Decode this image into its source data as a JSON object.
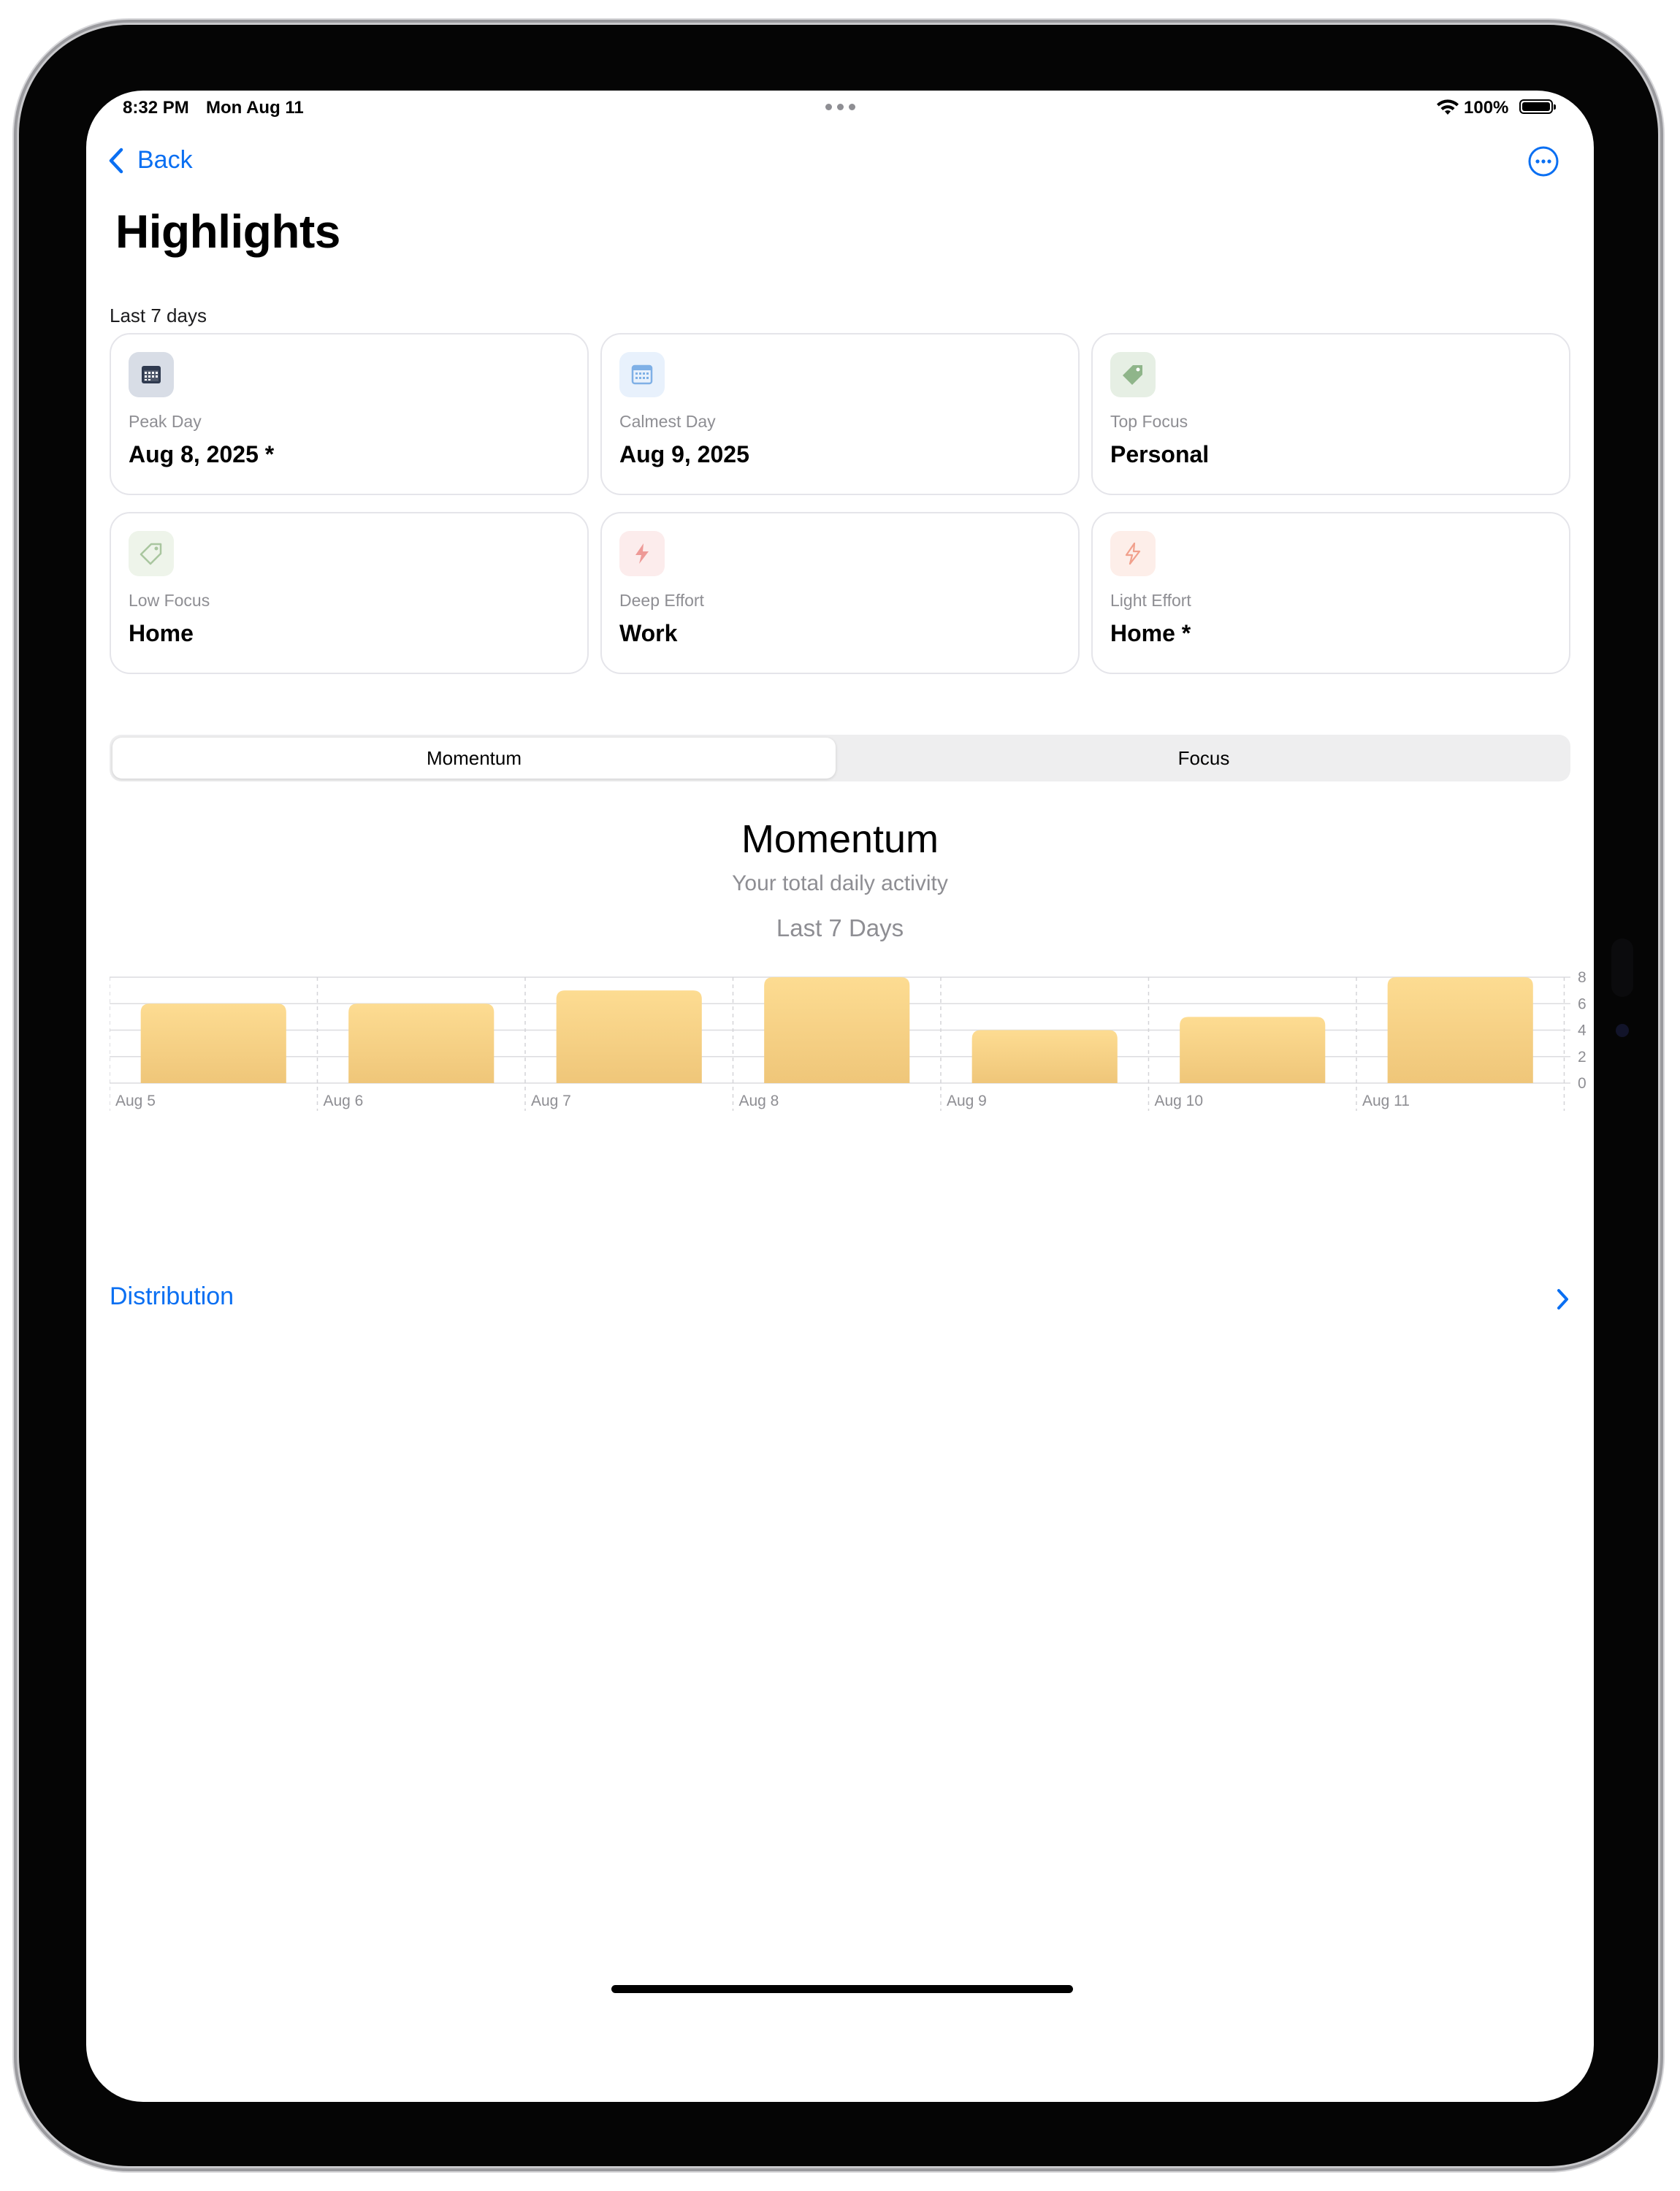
{
  "status_bar": {
    "time": "8:32 PM",
    "date": "Mon Aug 11",
    "battery": "100%"
  },
  "nav": {
    "back_label": "Back",
    "more_icon": "ellipsis-circle-icon"
  },
  "page": {
    "title": "Highlights",
    "section_label": "Last 7 days"
  },
  "cards": [
    {
      "label": "Peak Day",
      "value": "Aug 8, 2025 *",
      "icon": "calendar-icon",
      "icon_color": "#2f3a4f",
      "icon_bg": "#d8dde6"
    },
    {
      "label": "Calmest Day",
      "value": "Aug 9, 2025",
      "icon": "calendar-icon",
      "icon_color": "#7fb0e6",
      "icon_bg": "#e8f1fc"
    },
    {
      "label": "Top Focus",
      "value": "Personal",
      "icon": "tag-icon",
      "icon_color": "#8fb58a",
      "icon_bg": "#e6efe4"
    },
    {
      "label": "Low Focus",
      "value": "Home",
      "icon": "tag-icon",
      "icon_color": "#a9c69f",
      "icon_bg": "#eef4ea"
    },
    {
      "label": "Deep Effort",
      "value": "Work",
      "icon": "bolt-icon",
      "icon_color": "#ee9a97",
      "icon_bg": "#fcecec"
    },
    {
      "label": "Light Effort",
      "value": "Home *",
      "icon": "bolt-icon",
      "icon_color": "#f1a08c",
      "icon_bg": "#fdeee9"
    }
  ],
  "segmented": {
    "left": "Momentum",
    "right": "Focus",
    "selected": "Momentum"
  },
  "chart_header": {
    "title": "Momentum",
    "subtitle": "Your total daily activity",
    "range": "Last 7 Days"
  },
  "chart_data": {
    "type": "bar",
    "categories": [
      "Aug 5",
      "Aug 6",
      "Aug 7",
      "Aug 8",
      "Aug 9",
      "Aug 10",
      "Aug 11"
    ],
    "values": [
      6,
      6,
      7,
      8,
      4,
      5,
      8
    ],
    "ylim": [
      0,
      8
    ],
    "yticks": [
      "0",
      "2",
      "4",
      "6",
      "8"
    ],
    "bar_color_top": "#fddc92",
    "bar_color_bottom": "#efc679",
    "grid": true
  },
  "distribution": {
    "label": "Distribution"
  },
  "colors": {
    "accent": "#0a6ff2"
  }
}
